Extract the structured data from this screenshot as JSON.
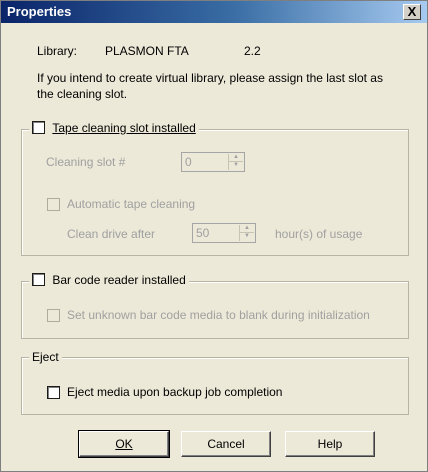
{
  "window": {
    "title": "Properties",
    "close_glyph": "X"
  },
  "library": {
    "label": "Library:",
    "name": "PLASMON FTA",
    "version": "2.2"
  },
  "info_text_line1": "If you intend to create virtual library, please assign the last slot as",
  "info_text_line2": "the cleaning slot.",
  "tape_group": {
    "checkbox_label": "Tape cleaning slot installed",
    "checked": false,
    "cleaning_slot_label": "Cleaning slot #",
    "cleaning_slot_value": "0",
    "auto_clean_label": "Automatic tape cleaning",
    "clean_after_label": "Clean drive after",
    "clean_after_value": "50",
    "usage_label": "hour(s) of usage"
  },
  "barcode_group": {
    "checkbox_label": "Bar code reader installed",
    "checked": false,
    "unknown_label": "Set unknown bar code media to blank during initialization"
  },
  "eject_group": {
    "legend": "Eject",
    "checkbox_label": "Eject media upon backup job completion",
    "checked": false
  },
  "buttons": {
    "ok": "OK",
    "cancel": "Cancel",
    "help": "Help"
  }
}
